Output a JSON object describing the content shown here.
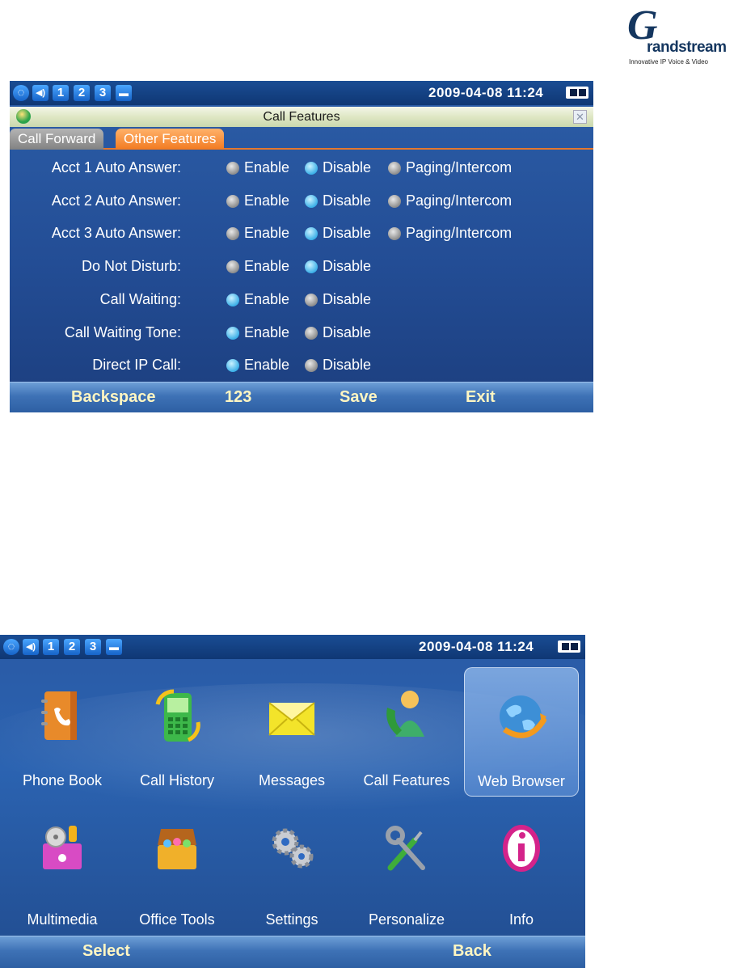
{
  "logo": {
    "mark": "G",
    "name": "randstream",
    "tagline": "Innovative IP Voice & Video"
  },
  "status_bar": {
    "line_keys": [
      "1",
      "2",
      "3"
    ],
    "datetime": "2009-04-08 11:24"
  },
  "call_features_screen": {
    "title": "Call Features",
    "tabs": [
      {
        "label": "Call Forward",
        "active": false
      },
      {
        "label": "Other Features",
        "active": true
      }
    ],
    "settings": [
      {
        "label": "Acct 1 Auto Answer:",
        "options": [
          "Enable",
          "Disable",
          "Paging/Intercom"
        ],
        "selected": "Disable"
      },
      {
        "label": "Acct 2 Auto Answer:",
        "options": [
          "Enable",
          "Disable",
          "Paging/Intercom"
        ],
        "selected": "Disable"
      },
      {
        "label": "Acct 3 Auto Answer:",
        "options": [
          "Enable",
          "Disable",
          "Paging/Intercom"
        ],
        "selected": "Disable"
      },
      {
        "label": "Do Not Disturb:",
        "options": [
          "Enable",
          "Disable"
        ],
        "selected": "Disable"
      },
      {
        "label": "Call Waiting:",
        "options": [
          "Enable",
          "Disable"
        ],
        "selected": "Enable"
      },
      {
        "label": "Call Waiting Tone:",
        "options": [
          "Enable",
          "Disable"
        ],
        "selected": "Enable"
      },
      {
        "label": "Direct IP Call:",
        "options": [
          "Enable",
          "Disable"
        ],
        "selected": "Enable"
      }
    ],
    "softkeys": [
      "Backspace",
      "123",
      "Save",
      "Exit"
    ]
  },
  "home_screen": {
    "menu_items": [
      {
        "label": "Phone Book",
        "icon": "phone-book-icon",
        "selected": false
      },
      {
        "label": "Call History",
        "icon": "call-history-icon",
        "selected": false
      },
      {
        "label": "Messages",
        "icon": "envelope-icon",
        "selected": false
      },
      {
        "label": "Call Features",
        "icon": "call-features-icon",
        "selected": false
      },
      {
        "label": "Web Browser",
        "icon": "globe-icon",
        "selected": true
      },
      {
        "label": "Multimedia",
        "icon": "multimedia-icon",
        "selected": false
      },
      {
        "label": "Office Tools",
        "icon": "toolbox-icon",
        "selected": false
      },
      {
        "label": "Settings",
        "icon": "gears-icon",
        "selected": false
      },
      {
        "label": "Personalize",
        "icon": "wrench-screwdriver-icon",
        "selected": false
      },
      {
        "label": "Info",
        "icon": "info-icon",
        "selected": false
      }
    ],
    "softkeys": [
      "Select",
      "Back"
    ]
  }
}
